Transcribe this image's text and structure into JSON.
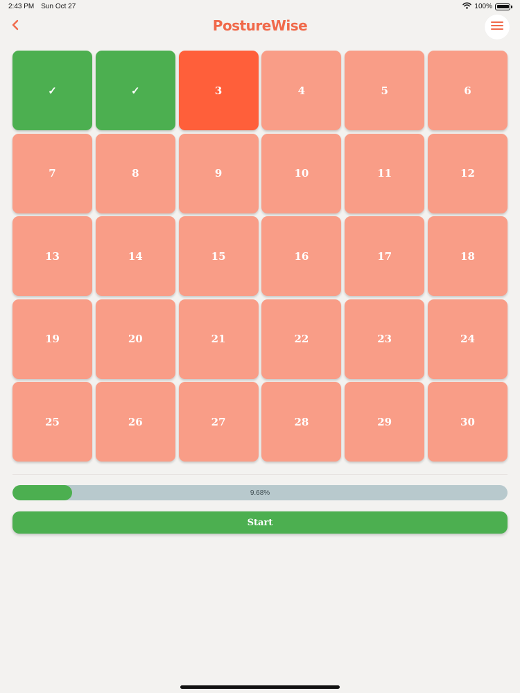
{
  "status_bar": {
    "time": "2:43 PM",
    "date": "Sun Oct 27",
    "battery_text": "100%"
  },
  "header": {
    "title": "PostureWise",
    "back_icon": "chevron-left-icon",
    "menu_icon": "hamburger-menu-icon"
  },
  "colors": {
    "brand": "#f0694a",
    "completed": "#4caf50",
    "current": "#ff5f3a",
    "locked": "#f99d87",
    "progress_track": "#b8c9cd"
  },
  "days": [
    {
      "label": "✓",
      "state": "completed"
    },
    {
      "label": "✓",
      "state": "completed"
    },
    {
      "label": "3",
      "state": "current"
    },
    {
      "label": "4",
      "state": "locked"
    },
    {
      "label": "5",
      "state": "locked"
    },
    {
      "label": "6",
      "state": "locked"
    },
    {
      "label": "7",
      "state": "locked"
    },
    {
      "label": "8",
      "state": "locked"
    },
    {
      "label": "9",
      "state": "locked"
    },
    {
      "label": "10",
      "state": "locked"
    },
    {
      "label": "11",
      "state": "locked"
    },
    {
      "label": "12",
      "state": "locked"
    },
    {
      "label": "13",
      "state": "locked"
    },
    {
      "label": "14",
      "state": "locked"
    },
    {
      "label": "15",
      "state": "locked"
    },
    {
      "label": "16",
      "state": "locked"
    },
    {
      "label": "17",
      "state": "locked"
    },
    {
      "label": "18",
      "state": "locked"
    },
    {
      "label": "19",
      "state": "locked"
    },
    {
      "label": "20",
      "state": "locked"
    },
    {
      "label": "21",
      "state": "locked"
    },
    {
      "label": "22",
      "state": "locked"
    },
    {
      "label": "23",
      "state": "locked"
    },
    {
      "label": "24",
      "state": "locked"
    },
    {
      "label": "25",
      "state": "locked"
    },
    {
      "label": "26",
      "state": "locked"
    },
    {
      "label": "27",
      "state": "locked"
    },
    {
      "label": "28",
      "state": "locked"
    },
    {
      "label": "29",
      "state": "locked"
    },
    {
      "label": "30",
      "state": "locked"
    }
  ],
  "progress": {
    "label": "9.68%",
    "percent": 9.68
  },
  "start_button": {
    "label": "Start"
  }
}
